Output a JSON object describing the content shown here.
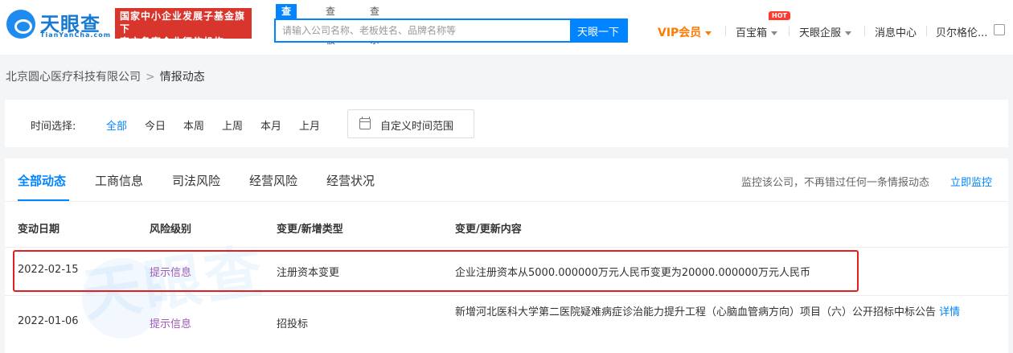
{
  "header": {
    "logo_text": "天眼查",
    "logo_sub": "TianYanCha.com",
    "badge_line1": "国家中小企业发展子基金旗下",
    "badge_line2": "官方备案企业征信机构",
    "search_tabs": [
      "查公司",
      "查老板",
      "查关系"
    ],
    "search_placeholder": "请输入公司名称、老板姓名、品牌名称等",
    "search_button": "天眼一下",
    "nav": {
      "vip": "VIP会员",
      "treasure": "百宝箱",
      "hot_badge": "HOT",
      "enterprise": "天眼企服",
      "messages": "消息中心",
      "user": "贝尔格伦..."
    }
  },
  "breadcrumb": {
    "company": "北京圆心医疗科技有限公司",
    "separator": ">",
    "current": "情报动态"
  },
  "filter": {
    "label": "时间选择:",
    "options": [
      "全部",
      "今日",
      "本周",
      "上周",
      "本月",
      "上月"
    ],
    "custom_range": "自定义时间范围"
  },
  "tabs": [
    "全部动态",
    "工商信息",
    "司法风险",
    "经营风险",
    "经营状况"
  ],
  "monitor": {
    "text": "监控该公司，不再错过任何一条情报动态",
    "link": "立即监控"
  },
  "table": {
    "headers": [
      "变动日期",
      "风险级别",
      "变更/新增类型",
      "变更/更新内容"
    ],
    "rows": [
      {
        "date": "2022-02-15",
        "risk": "提示信息",
        "type": "注册资本变更",
        "content": "企业注册资本从5000.000000万元人民币变更为20000.000000万元人民币"
      },
      {
        "date": "2022-01-06",
        "risk": "提示信息",
        "type": "招投标",
        "content": "新增河北医科大学第二医院疑难病症诊治能力提升工程（心脑血管病方向）项目（六）公开招标中标公告",
        "detail": "详情"
      }
    ]
  },
  "watermark": "天眼查",
  "colors": {
    "accent": "#0084ff",
    "badge_red": "#d8352c",
    "vip_orange": "#ff7a00",
    "risk_purple": "#9b59b6",
    "highlight_red": "#e02020"
  }
}
